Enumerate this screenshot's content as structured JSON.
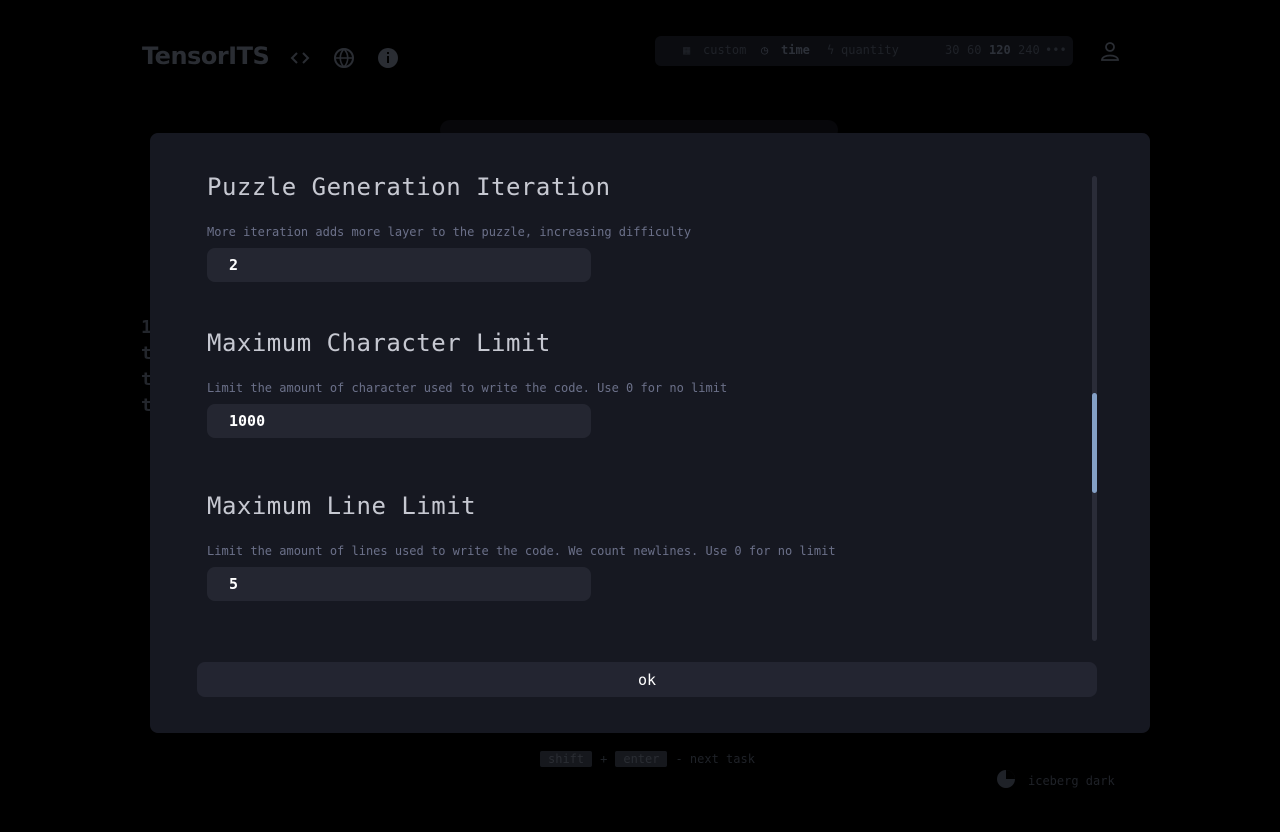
{
  "app": {
    "logo": "TensorITS"
  },
  "modebar": {
    "custom": "custom",
    "time": "time",
    "quantity": "quantity",
    "times": [
      "30",
      "60",
      "120",
      "240"
    ],
    "more": "•••"
  },
  "bg_lines": [
    "1",
    "t",
    "t",
    "t"
  ],
  "footer": {
    "key1": "shift",
    "plus": "+",
    "key2": "enter",
    "action": "- next task"
  },
  "theme": {
    "name": "iceberg dark"
  },
  "modal": {
    "settings": [
      {
        "title": "Puzzle Generation Iteration",
        "description": "More iteration adds more layer to the puzzle, increasing difficulty",
        "value": "2"
      },
      {
        "title": "Maximum Character Limit",
        "description": "Limit the amount of character used to write the code. Use 0 for no limit",
        "value": "1000"
      },
      {
        "title": "Maximum Line Limit",
        "description": "Limit the amount of lines used to write the code. We count newlines. Use 0 for no limit",
        "value": "5"
      }
    ],
    "ok_label": "ok"
  },
  "colors": {
    "modal_bg": "#161821",
    "input_bg": "#242631",
    "accent": "#84a0c6",
    "subtext": "#6b7089"
  }
}
